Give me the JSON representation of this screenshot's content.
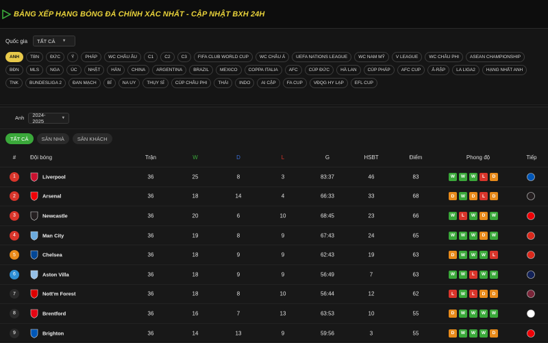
{
  "header": {
    "title": "BẢNG XẾP HẠNG BÓNG ĐÁ CHÍNH XÁC NHẤT - CẬP NHẬT BXH 24H"
  },
  "filter": {
    "country_label": "Quốc gia",
    "country_value": "TẤT CẢ",
    "leagues": [
      "ANH",
      "TBN",
      "ĐỨC",
      "Ý",
      "PHÁP",
      "WC CHÂU ÂU",
      "C1",
      "C2",
      "C3",
      "FIFA CLUB WORLD CUP",
      "WC CHÂU Á",
      "UEFA NATIONS LEAGUE",
      "WC NAM MỸ",
      "V LEAGUE",
      "WC CHÂU PHI",
      "ASEAN CHAMPIONSHIP",
      "BĐN",
      "MLS",
      "NGA",
      "ÚC",
      "NHẬT",
      "HÀN",
      "CHINA",
      "ARGENTINA",
      "BRAZIL",
      "MEXICO",
      "COPPA ITALIA",
      "AFC",
      "CÚP ĐỨC",
      "HÀ LAN",
      "CÚP PHÁP",
      "AFC CUP",
      "Ả-RẬP",
      "LA LIGA2",
      "HẠNG NHẤT ANH",
      "TNK",
      "BUNDESLIGA 2",
      "ĐAN MẠCH",
      "BỈ",
      "NA UY",
      "THỤY SĨ",
      "CÚP CHÂU PHI",
      "THÁI",
      "INDO",
      "AI CẬP",
      "FA CUP",
      "VĐQG HY LẠP",
      "EFL CUP"
    ],
    "active_league": "ANH"
  },
  "table": {
    "league_label": "Anh",
    "season": "2024-2025",
    "tabs": [
      "TẤT CẢ",
      "SÂN NHÀ",
      "SÂN KHÁCH"
    ],
    "headers": {
      "rank": "#",
      "team": "Đội bóng",
      "played": "Trận",
      "w": "W",
      "d": "D",
      "l": "L",
      "g": "G",
      "hsbt": "HSBT",
      "points": "Điểm",
      "form": "Phong độ",
      "next": "Tiếp"
    },
    "rows": [
      {
        "rank": "1",
        "team": "Liverpool",
        "played": "36",
        "w": "25",
        "d": "8",
        "l": "3",
        "g": "83:37",
        "hsbt": "46",
        "points": "83",
        "form": [
          "W",
          "W",
          "W",
          "L",
          "D"
        ],
        "rank_color": "#d9352b",
        "crest": "#c8102e",
        "next_crest": "#0057b8"
      },
      {
        "rank": "2",
        "team": "Arsenal",
        "played": "36",
        "w": "18",
        "d": "14",
        "l": "4",
        "g": "66:33",
        "hsbt": "33",
        "points": "68",
        "form": [
          "D",
          "W",
          "D",
          "L",
          "D"
        ],
        "rank_color": "#d9352b",
        "crest": "#ef0107",
        "next_crest": "#241f20"
      },
      {
        "rank": "3",
        "team": "Newcastle",
        "played": "36",
        "w": "20",
        "d": "6",
        "l": "10",
        "g": "68:45",
        "hsbt": "23",
        "points": "66",
        "form": [
          "W",
          "L",
          "W",
          "D",
          "W"
        ],
        "rank_color": "#d9352b",
        "crest": "#241f20",
        "next_crest": "#ef0107"
      },
      {
        "rank": "4",
        "team": "Man City",
        "played": "36",
        "w": "19",
        "d": "8",
        "l": "9",
        "g": "67:43",
        "hsbt": "24",
        "points": "65",
        "form": [
          "W",
          "W",
          "W",
          "D",
          "W"
        ],
        "rank_color": "#d9352b",
        "crest": "#6cabdd",
        "next_crest": "#da291c"
      },
      {
        "rank": "5",
        "team": "Chelsea",
        "played": "36",
        "w": "18",
        "d": "9",
        "l": "9",
        "g": "62:43",
        "hsbt": "19",
        "points": "63",
        "form": [
          "D",
          "W",
          "W",
          "W",
          "L"
        ],
        "rank_color": "#e88a1a",
        "crest": "#034694",
        "next_crest": "#da291c"
      },
      {
        "rank": "6",
        "team": "Aston Villa",
        "played": "36",
        "w": "18",
        "d": "9",
        "l": "9",
        "g": "56:49",
        "hsbt": "7",
        "points": "63",
        "form": [
          "W",
          "W",
          "L",
          "W",
          "W"
        ],
        "rank_color": "#2e8fd6",
        "crest": "#95bfe5",
        "next_crest": "#132257"
      },
      {
        "rank": "7",
        "team": "Nott'm Forest",
        "played": "36",
        "w": "18",
        "d": "8",
        "l": "10",
        "g": "56:44",
        "hsbt": "12",
        "points": "62",
        "form": [
          "L",
          "W",
          "L",
          "D",
          "D"
        ],
        "rank_color": "#2a2a2a",
        "crest": "#dd0000",
        "next_crest": "#7a263a"
      },
      {
        "rank": "8",
        "team": "Brentford",
        "played": "36",
        "w": "16",
        "d": "7",
        "l": "13",
        "g": "63:53",
        "hsbt": "10",
        "points": "55",
        "form": [
          "D",
          "W",
          "W",
          "W",
          "W"
        ],
        "rank_color": "#2a2a2a",
        "crest": "#e30613",
        "next_crest": "#ffffff"
      },
      {
        "rank": "9",
        "team": "Brighton",
        "played": "36",
        "w": "14",
        "d": "13",
        "l": "9",
        "g": "59:56",
        "hsbt": "3",
        "points": "55",
        "form": [
          "D",
          "W",
          "W",
          "W",
          "D"
        ],
        "rank_color": "#2a2a2a",
        "crest": "#0057b8",
        "next_crest": "#ef0107"
      }
    ]
  },
  "colors": {
    "accent": "#e8c94a",
    "win": "#3aa83a",
    "draw": "#e88a1a",
    "loss": "#d9352b",
    "w_header": "#3aa83a",
    "d_header": "#2e6fd6",
    "l_header": "#d9352b"
  }
}
